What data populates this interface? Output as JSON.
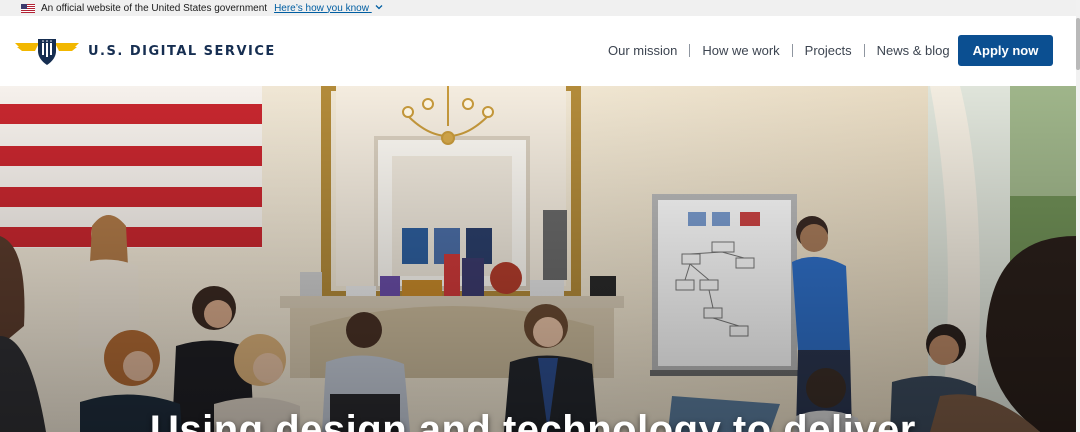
{
  "gov_banner": {
    "text": "An official website of the United States government",
    "link": "Here’s how you know"
  },
  "header": {
    "logo_text": "U.S. DIGITAL SERVICE",
    "nav": [
      "Our mission",
      "How we work",
      "Projects",
      "News & blog"
    ],
    "apply_label": "Apply now"
  },
  "hero": {
    "headline": "Using design and technology to deliver"
  },
  "colors": {
    "navy": "#162e51",
    "button": "#0b4f91",
    "link": "#005ea2",
    "banner_bg": "#f0f0f0",
    "logo_gold": "#f2b700"
  },
  "icons": [
    "us-flag-icon",
    "chevron-down-icon",
    "usds-eagle-logo-icon"
  ]
}
